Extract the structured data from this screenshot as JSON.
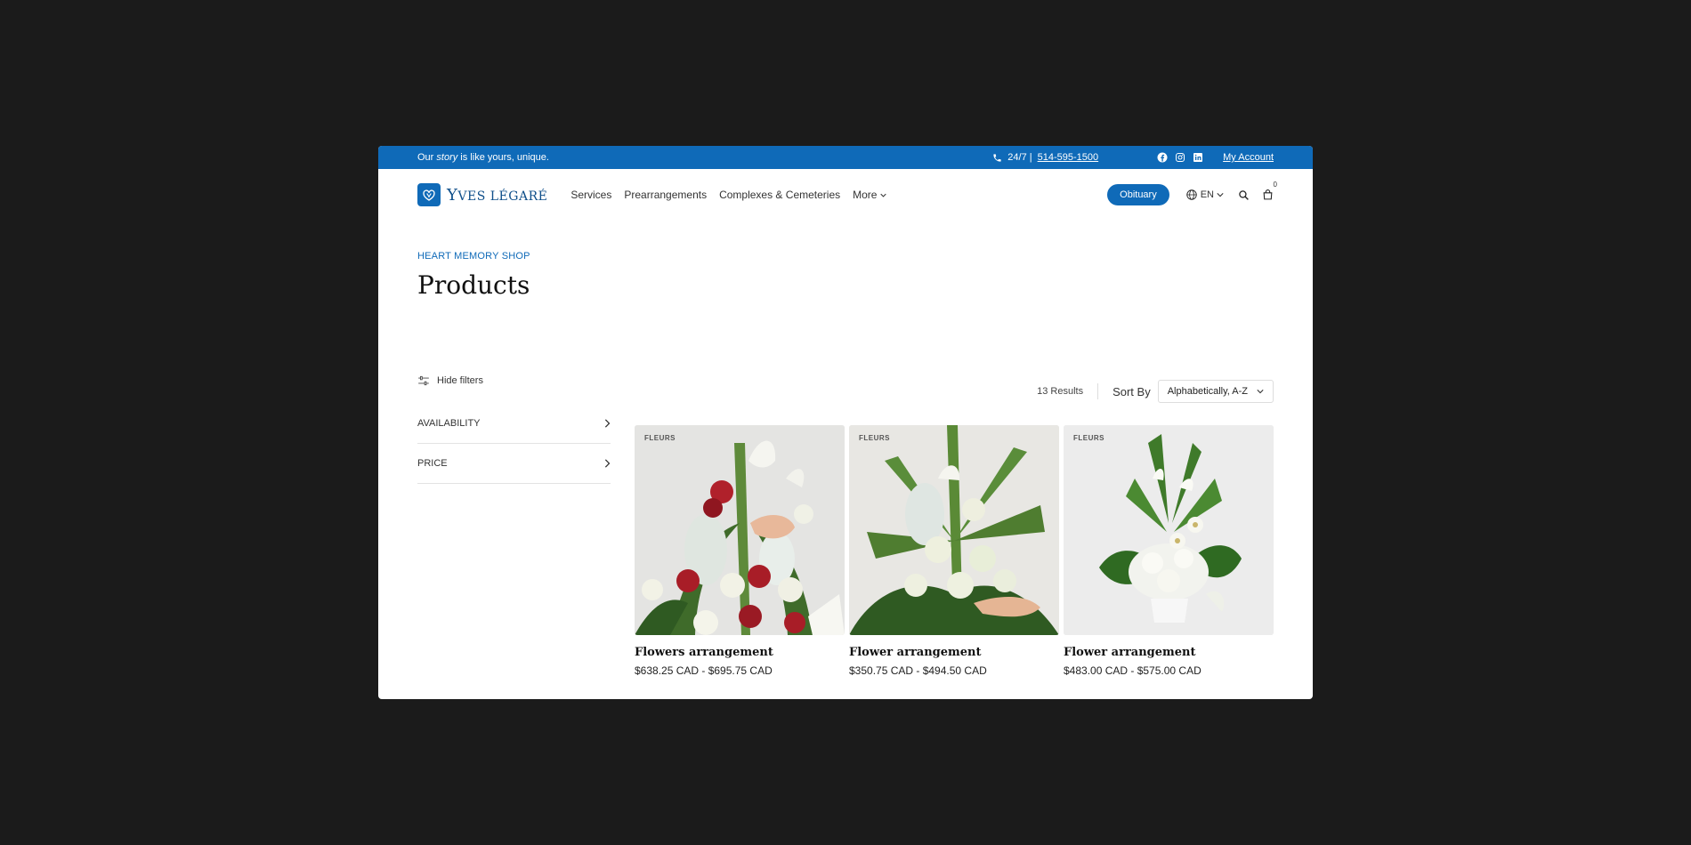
{
  "topbar": {
    "tagline_pre": "Our ",
    "tagline_em": "story",
    "tagline_post": " is like yours, unique.",
    "hours": "24/7 |",
    "phone": "514-595-1500",
    "account": "My Account"
  },
  "nav": {
    "logo_text_big": "Y",
    "logo_text_rest": "VES LÉGARÉ",
    "items": [
      "Services",
      "Prearrangements",
      "Complexes & Cemeteries",
      "More"
    ],
    "obituary": "Obituary",
    "lang": "EN",
    "cart_count": "0"
  },
  "hero": {
    "breadcrumb": "HEART MEMORY SHOP",
    "title": "Products"
  },
  "filters": {
    "toggle_label": "Hide filters",
    "facets": [
      "AVAILABILITY",
      "PRICE"
    ]
  },
  "results": {
    "count": "13 Results",
    "sort_label": "Sort By",
    "sort_value": "Alphabetically, A-Z"
  },
  "products": [
    {
      "badge": "FLEURS",
      "name": "Flowers arrangement",
      "price": "$638.25 CAD - $695.75 CAD"
    },
    {
      "badge": "FLEURS",
      "name": "Flower arrangement",
      "price": "$350.75 CAD - $494.50 CAD"
    },
    {
      "badge": "FLEURS",
      "name": "Flower arrangement",
      "price": "$483.00 CAD - $575.00 CAD"
    }
  ],
  "colors": {
    "brand": "#0f6ab8",
    "background": "#1b1b1b"
  }
}
